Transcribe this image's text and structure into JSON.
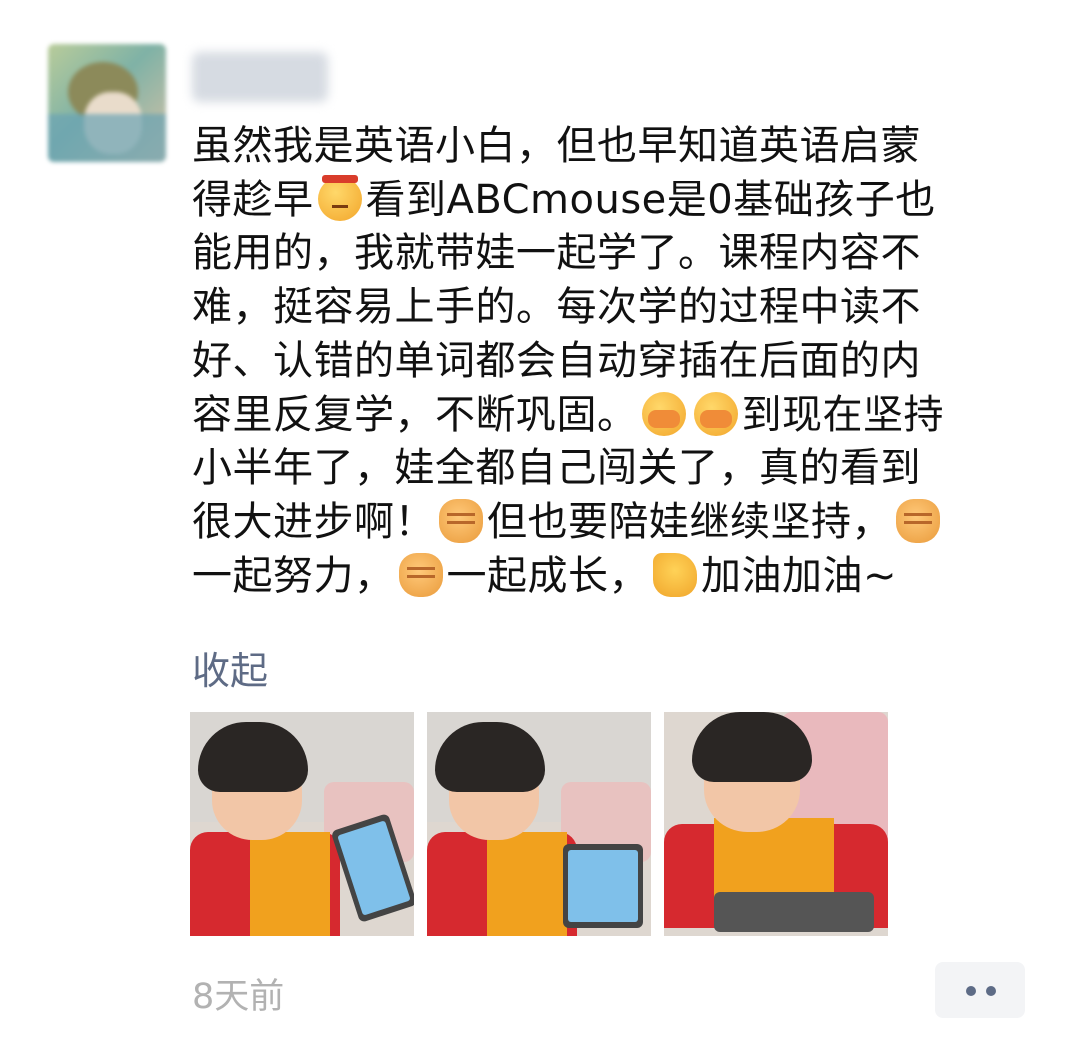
{
  "post": {
    "lines": {
      "l1": "虽然我是英语小白，但也早知道英语启蒙",
      "l2a": "得趁早",
      "l2b": "看到ABCmouse是0基础孩子也",
      "l3": "能用的，我就带娃一起学了。课程内容不",
      "l4": "难，挺容易上手的。每次学的过程中读不",
      "l5": "好、认错的单词都会自动穿插在后面的内",
      "l6a": "容里反复学，不断巩固。",
      "l6b": "到现在坚持",
      "l7": "小半年了，娃全都自己闯关了，真的看到",
      "l8a": "很大进步啊！",
      "l8b": "但也要陪娃继续坚持，",
      "l9a": "一起努力，",
      "l9b": "一起成长，",
      "l9c": "加油加油~"
    },
    "emoji": [
      "frown-emoji",
      "cover-mouth-emoji",
      "cover-mouth-emoji",
      "fist-emoji",
      "fist-emoji",
      "fist-emoji",
      "muscle-emoji"
    ],
    "collapse_label": "收起",
    "photos": [
      {
        "subject": "girl-with-tablet-1"
      },
      {
        "subject": "girl-with-tablet-2"
      },
      {
        "subject": "girl-with-tablet-3"
      }
    ],
    "timestamp": "8天前",
    "more_icon": "ellipsis-icon"
  },
  "colors": {
    "text": "#111111",
    "link": "#5e6b85",
    "timestamp": "#b2b2b2",
    "button_bg": "#f3f4f6"
  }
}
